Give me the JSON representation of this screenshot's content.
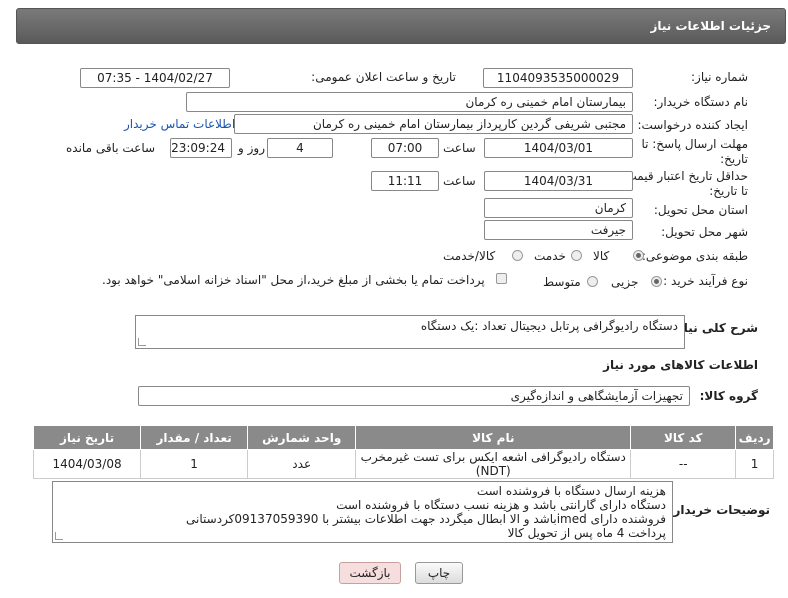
{
  "header": {
    "title": "جزئیات اطلاعات نیاز"
  },
  "fields": {
    "need_number_label": "شماره نیاز:",
    "need_number": "1104093535000029",
    "announce_label": "تاریخ و ساعت اعلان عمومی:",
    "announce_value": "1404/02/27 - 07:35",
    "buyer_org_label": "نام دستگاه خریدار:",
    "buyer_org": "بیمارستان امام خمینی  ره  کرمان",
    "creator_label": "ایجاد کننده درخواست:",
    "creator": "مجتبی شریفی گردین کارپرداز بیمارستان امام خمینی  ره  کرمان",
    "contact_link": "اطلاعات تماس خریدار",
    "deadline_label_1": "مهلت ارسال پاسخ: تا",
    "deadline_label_2": "تاریخ:",
    "deadline_date": "1404/03/01",
    "time_label": "ساعت",
    "deadline_time": "07:00",
    "days_value": "4",
    "days_label": "روز و",
    "remaining_time": "23:09:24",
    "remaining_label": "ساعت باقی مانده",
    "validity_label_1": "حداقل تاریخ اعتبار قیمت:",
    "validity_label_2": "تا تاریخ:",
    "validity_date": "1404/03/31",
    "validity_time": "11:11",
    "province_label": "استان محل تحویل:",
    "province": "کرمان",
    "city_label": "شهر محل تحویل:",
    "city": "جیرفت",
    "category_label": "طبقه بندی موضوعی:",
    "category_options": [
      "کالا",
      "خدمت",
      "کالا/خدمت"
    ],
    "category_selected": "کالا",
    "process_label": "نوع فرآیند خرید :",
    "process_options": [
      "جزیی",
      "متوسط"
    ],
    "process_selected": "جزیی",
    "payment_note": "پرداخت تمام یا بخشی از مبلغ خرید،از محل \"اسناد خزانه اسلامی\" خواهد بود.",
    "description_label": "شرح کلی نیاز:",
    "description": "دستگاه رادیوگرافی پرتابل دیجیتال       تعداد :یک دستگاه"
  },
  "goods": {
    "section_title": "اطلاعات کالاهای مورد نیاز",
    "group_label": "گروه کالا:",
    "group_value": "تجهیزات آزمایشگاهی و اندازه‌گیری",
    "columns": [
      "ردیف",
      "کد کالا",
      "نام کالا",
      "واحد شمارش",
      "تعداد / مقدار",
      "تاریخ نیاز"
    ],
    "rows": [
      {
        "row": "1",
        "code": "--",
        "name": "دستگاه رادیوگرافی اشعه ایکس برای تست غیرمخرب (NDT)",
        "unit": "عدد",
        "qty": "1",
        "date": "1404/03/08"
      }
    ]
  },
  "buyer_notes": {
    "label": "توضیحات خریدار:",
    "lines": [
      "هزینه ارسال  دستگاه با فروشنده است",
      "دستگاه دارای گارانتی باشد  و هزینه نسب دستگاه با فروشنده است",
      "فروشنده دارای imedباشد و الا ابطال میگردد جهت اطلاعات بیشتر با 09137059390کردستانی",
      "پرداخت 4 ماه پس از تحویل کالا"
    ]
  },
  "buttons": {
    "print": "چاپ",
    "back": "بازگشت"
  }
}
